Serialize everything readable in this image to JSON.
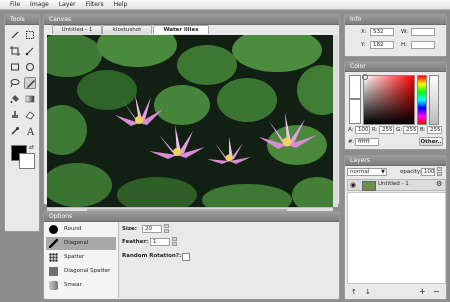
{
  "menu": [
    "File",
    "Image",
    "Layer",
    "Filters",
    "Help"
  ],
  "tools_panel": {
    "title": "Tools"
  },
  "tools": [
    {
      "name": "pencil-icon"
    },
    {
      "name": "marquee-icon"
    },
    {
      "name": "crop-icon"
    },
    {
      "name": "brush-icon"
    },
    {
      "name": "rectangle-icon"
    },
    {
      "name": "ellipse-icon"
    },
    {
      "name": "lasso-icon"
    },
    {
      "name": "pen-icon"
    },
    {
      "name": "fill-icon"
    },
    {
      "name": "gradient-icon"
    },
    {
      "name": "clone-icon"
    },
    {
      "name": "eraser-icon"
    },
    {
      "name": "eyedropper-icon"
    },
    {
      "name": "text-icon"
    }
  ],
  "canvas": {
    "title": "Canvas",
    "tabs": [
      "Untitled - 1",
      "klostushot",
      "Water lilies"
    ],
    "active_tab": 2
  },
  "info": {
    "title": "Info",
    "x_label": "X:",
    "x_value": "532",
    "y_label": "Y:",
    "y_value": "182",
    "w_label": "W:",
    "w_value": "",
    "h_label": "H:",
    "h_value": ""
  },
  "color": {
    "title": "Color",
    "a_label": "A:",
    "a_value": "100",
    "r_label": "R:",
    "r_value": "255",
    "g_label": "G:",
    "g_value": "255",
    "b_label": "B:",
    "b_value": "255",
    "hex_label": "#:",
    "hex_value": "ffffff",
    "other_button": "Other..",
    "hue": "#ff0000"
  },
  "layers": {
    "title": "Layers",
    "blend_mode": "normal",
    "opacity_label": "opacity:",
    "opacity_value": "100",
    "layer_name": "Untitled - 1"
  },
  "options": {
    "title": "Options",
    "brushes": [
      "Round",
      "Diagonal",
      "Spatter",
      "Diagonal Spatter",
      "Smear"
    ],
    "selected_brush": 1,
    "size_label": "Size:",
    "size_value": "20",
    "feather_label": "Feather:",
    "feather_value": "1",
    "random_rotation_label": "Random Rotation?:"
  }
}
